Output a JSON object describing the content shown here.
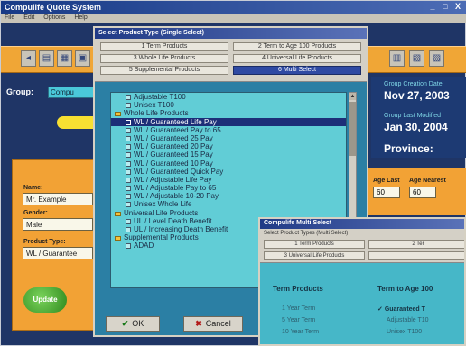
{
  "main_window": {
    "title": "Compulife Quote System",
    "menu": [
      "File",
      "Edit",
      "Options",
      "Help"
    ],
    "controls": "_ □ X",
    "group_label": "Group:",
    "group_value": "Compu",
    "name_label": "Name:",
    "name_value": "Mr. Example",
    "gender_label": "Gender:",
    "gender_value": "Male",
    "product_type_label": "Product Type:",
    "product_type_value": "WL / Guarantee",
    "update_button": "Update",
    "creation_label": "Group Creation Date",
    "creation_date": "Nov 27, 2003",
    "modified_label": "Group Last Modified",
    "modified_date": "Jan 30, 2004",
    "province_label": "Province:",
    "age_last_label": "Age Last",
    "age_last_value": "60",
    "age_nearest_label": "Age Nearest",
    "age_nearest_value": "60"
  },
  "product_dialog": {
    "title": "Select Product Type (Single Select)",
    "tabs": [
      "1 Term Products",
      "2 Term to Age 100 Products",
      "3 Whole Life Products",
      "4 Universal Life Products",
      "5 Supplemental Products",
      "6 Multi Select"
    ],
    "list": [
      {
        "text": "Adjustable T100",
        "type": "item"
      },
      {
        "text": "Unisex T100",
        "type": "item"
      },
      {
        "text": "Whole Life Products",
        "type": "cat"
      },
      {
        "text": "WL / Guaranteed Life Pay",
        "type": "item",
        "selected": true
      },
      {
        "text": "WL / Guaranteed Pay to 65",
        "type": "item"
      },
      {
        "text": "WL / Guaranteed 25 Pay",
        "type": "item"
      },
      {
        "text": "WL / Guaranteed 20 Pay",
        "type": "item"
      },
      {
        "text": "WL / Guaranteed 15 Pay",
        "type": "item"
      },
      {
        "text": "WL / Guaranteed 10 Pay",
        "type": "item"
      },
      {
        "text": "WL / Guaranteed Quick Pay",
        "type": "item"
      },
      {
        "text": "WL / Adjustable Life Pay",
        "type": "item"
      },
      {
        "text": "WL / Adjustable Pay to 65",
        "type": "item"
      },
      {
        "text": "WL / Adjustable 10-20 Pay",
        "type": "item"
      },
      {
        "text": "Unisex Whole Life",
        "type": "item"
      },
      {
        "text": "Universal Life Products",
        "type": "cat"
      },
      {
        "text": "UL / Level Death Benefit",
        "type": "item"
      },
      {
        "text": "UL / Increasing Death Benefit",
        "type": "item"
      },
      {
        "text": "Supplemental Products",
        "type": "cat"
      },
      {
        "text": "ADAD",
        "type": "item"
      }
    ],
    "ok_button": "OK",
    "cancel_button": "Cancel"
  },
  "multi_dialog": {
    "title": "Compulife Multi Select",
    "subtitle": "Select Product Types (Multi Select)",
    "tabs": [
      "1 Term Products",
      "2 Ter",
      "3 Universal Life Products"
    ],
    "col1_head": "Term Products",
    "col2_head": "Term to Age 100",
    "col1_items": [
      "1 Year Term",
      "5 Year Term",
      "10 Year Term"
    ],
    "col2_items": [
      "Guaranteed T",
      "Adjustable T10",
      "Unisex T100"
    ]
  },
  "colors": {
    "accent_orange": "#f2a235",
    "list_cyan": "#61cdd6",
    "selection": "#1d2f78",
    "dialog_blue": "#2b7fa4"
  }
}
